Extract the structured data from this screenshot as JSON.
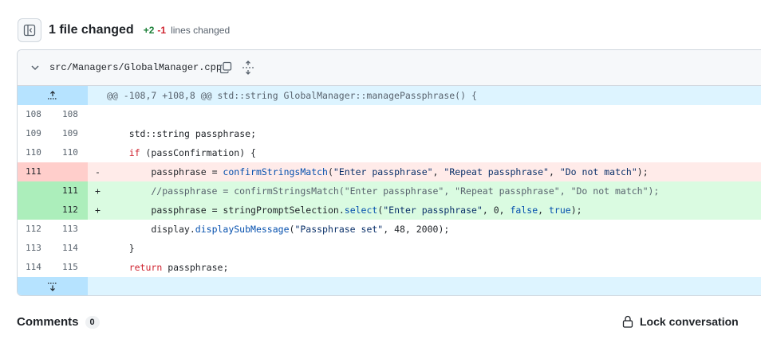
{
  "summary": {
    "title": "1 file changed",
    "additions": "+2",
    "deletions": "-1",
    "lines_label": "lines changed"
  },
  "file": {
    "path": "src/Managers/GlobalManager.cpp",
    "hunk_header": "@@ -108,7 +108,8 @@ std::string GlobalManager::managePassphrase() {",
    "lines": [
      {
        "type": "ctx",
        "old": "108",
        "new": "108",
        "sign": "",
        "code": ""
      },
      {
        "type": "ctx",
        "old": "109",
        "new": "109",
        "sign": "",
        "code": "    std::string passphrase;"
      },
      {
        "type": "ctx",
        "old": "110",
        "new": "110",
        "sign": "",
        "code": "    if (passConfirmation) {"
      },
      {
        "type": "del",
        "old": "111",
        "new": "",
        "sign": "-",
        "code": "        passphrase = confirmStringsMatch(\"Enter passphrase\", \"Repeat passphrase\", \"Do not match\");"
      },
      {
        "type": "add",
        "old": "",
        "new": "111",
        "sign": "+",
        "code": "        //passphrase = confirmStringsMatch(\"Enter passphrase\", \"Repeat passphrase\", \"Do not match\");"
      },
      {
        "type": "add",
        "old": "",
        "new": "112",
        "sign": "+",
        "code": "        passphrase = stringPromptSelection.select(\"Enter passphrase\", 0, false, true);"
      },
      {
        "type": "ctx",
        "old": "112",
        "new": "113",
        "sign": "",
        "code": "        display.displaySubMessage(\"Passphrase set\", 48, 2000);"
      },
      {
        "type": "ctx",
        "old": "113",
        "new": "114",
        "sign": "",
        "code": "    }"
      },
      {
        "type": "ctx",
        "old": "114",
        "new": "115",
        "sign": "",
        "code": "    return passphrase;"
      }
    ]
  },
  "comments": {
    "title": "Comments",
    "count": "0",
    "lock_label": "Lock conversation"
  },
  "colors": {
    "accent": "#0969da",
    "addition": "#1a7f37",
    "deletion": "#cf222e"
  }
}
